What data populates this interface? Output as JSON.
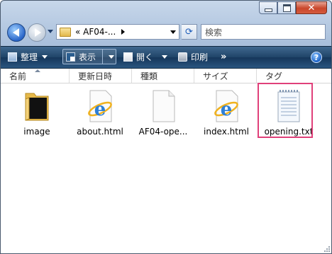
{
  "address_bar": {
    "path_label": "« AF04-...",
    "refresh_icon": "refresh-icon"
  },
  "search": {
    "placeholder": "検索"
  },
  "toolbar": {
    "organize_label": "整理",
    "views_label": "表示",
    "open_label": "開く",
    "print_label": "印刷",
    "more_label": "»"
  },
  "columns": [
    {
      "label": "名前"
    },
    {
      "label": "更新日時"
    },
    {
      "label": "種類"
    },
    {
      "label": "サイズ"
    },
    {
      "label": "タグ"
    }
  ],
  "files": [
    {
      "name": "image",
      "icon": "folder-icon"
    },
    {
      "name": "about.html",
      "icon": "internet-explorer-icon"
    },
    {
      "name": "AF04-ope...",
      "icon": "blank-file-icon"
    },
    {
      "name": "index.html",
      "icon": "internet-explorer-icon"
    },
    {
      "name": "opening.txt",
      "icon": "text-file-icon",
      "selected": true
    }
  ],
  "colors": {
    "selection_highlight": "#e0407a",
    "toolbar": "#1f4468",
    "close_button": "#c9462b"
  }
}
